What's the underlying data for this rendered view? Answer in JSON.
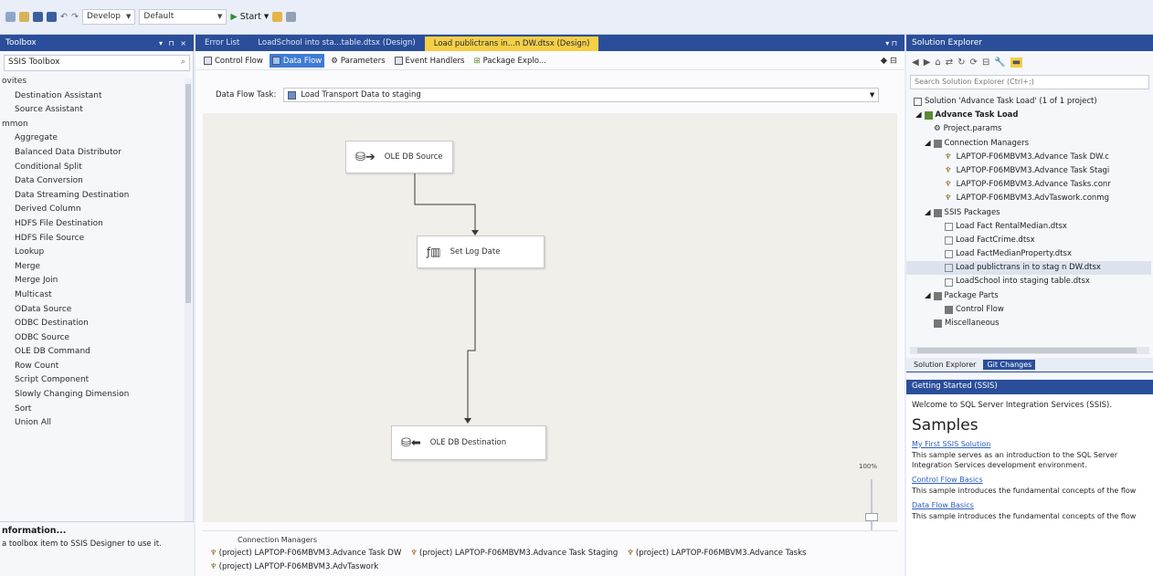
{
  "toolbar": {
    "config_value": "Develop",
    "platform_value": "Default",
    "start_label": "Start"
  },
  "toolbox": {
    "title": "Toolbox",
    "search_value": "SSIS Toolbox",
    "categories": [
      {
        "label": "ovites",
        "items": [
          "Destination Assistant",
          "Source Assistant"
        ]
      },
      {
        "label": "mmon",
        "items": [
          "Aggregate",
          "Balanced Data Distributor",
          "Conditional Split",
          "Data Conversion",
          "Data Streaming Destination",
          "Derived Column",
          "HDFS File Destination",
          "HDFS File Source",
          "Lookup",
          "Merge",
          "Merge Join",
          "Multicast",
          "OData Source",
          "ODBC Destination",
          "ODBC Source",
          "OLE DB Command",
          "Row Count",
          "Script Component",
          "Slowly Changing Dimension",
          "Sort",
          "Union All"
        ]
      }
    ],
    "info_title": "nformation...",
    "info_text": "a toolbox item to SSIS Designer to use it."
  },
  "editor": {
    "tabs": [
      "Error List",
      "LoadSchool into sta...table.dtsx (Design)",
      "Load publictrans in...n DW.dtsx (Design)"
    ],
    "designer_tabs": [
      "Control Flow",
      "Data Flow",
      "Parameters",
      "Event Handlers",
      "Package Explo..."
    ],
    "data_flow_task_label": "Data Flow Task:",
    "data_flow_task_value": "Load Transport Data to staging",
    "components": {
      "source": "OLE DB Source",
      "derived": "Set Log Date",
      "destination": "OLE DB Destination"
    },
    "zoom": "100%",
    "connection_managers_title": "Connection Managers",
    "connections": [
      "(project) LAPTOP-F06MBVM3.Advance Task DW",
      "(project) LAPTOP-F06MBVM3.Advance Task Staging",
      "(project) LAPTOP-F06MBVM3.Advance Tasks",
      "(project) LAPTOP-F06MBVM3.AdvTaswork"
    ]
  },
  "solution": {
    "title": "Solution Explorer",
    "search_placeholder": "Search Solution Explorer (Ctrl+;)",
    "tree": {
      "solution": "Solution 'Advance Task Load' (1 of 1 project)",
      "project": "Advance Task Load",
      "params": "Project.params",
      "conn_mgrs": "Connection Managers",
      "conns": [
        "LAPTOP-F06MBVM3.Advance Task DW.c",
        "LAPTOP-F06MBVM3.Advance Task Stagi",
        "LAPTOP-F06MBVM3.Advance Tasks.conr",
        "LAPTOP-F06MBVM3.AdvTaswork.conmg"
      ],
      "packages": "SSIS Packages",
      "package_files": [
        "Load Fact RentalMedian.dtsx",
        "Load FactCrime.dtsx",
        "Load FactMedianProperty.dtsx",
        "Load publictrans in to stag n DW.dtsx",
        "LoadSchool into staging table.dtsx"
      ],
      "package_parts": "Package Parts",
      "control_flow": "Control Flow",
      "misc": "Miscellaneous"
    },
    "bottom_tabs": [
      "Solution Explorer",
      "Git Changes"
    ]
  },
  "getting_started": {
    "title": "Getting Started (SSIS)",
    "welcome": "Welcome to SQL Server Integration Services (SSIS).",
    "samples_heading": "Samples",
    "samples": [
      {
        "title": "My First SSIS Solution",
        "desc": "This sample serves as an introduction to the SQL Server Integration Services development environment."
      },
      {
        "title": "Control Flow Basics",
        "desc": "This sample introduces the fundamental concepts of the flow"
      },
      {
        "title": "Data Flow Basics",
        "desc": "This sample introduces the fundamental concepts of the flow"
      }
    ]
  },
  "colors": {
    "accent": "#2a4e9a",
    "active_tab": "#f5cf45",
    "canvas": "#f1efea"
  }
}
